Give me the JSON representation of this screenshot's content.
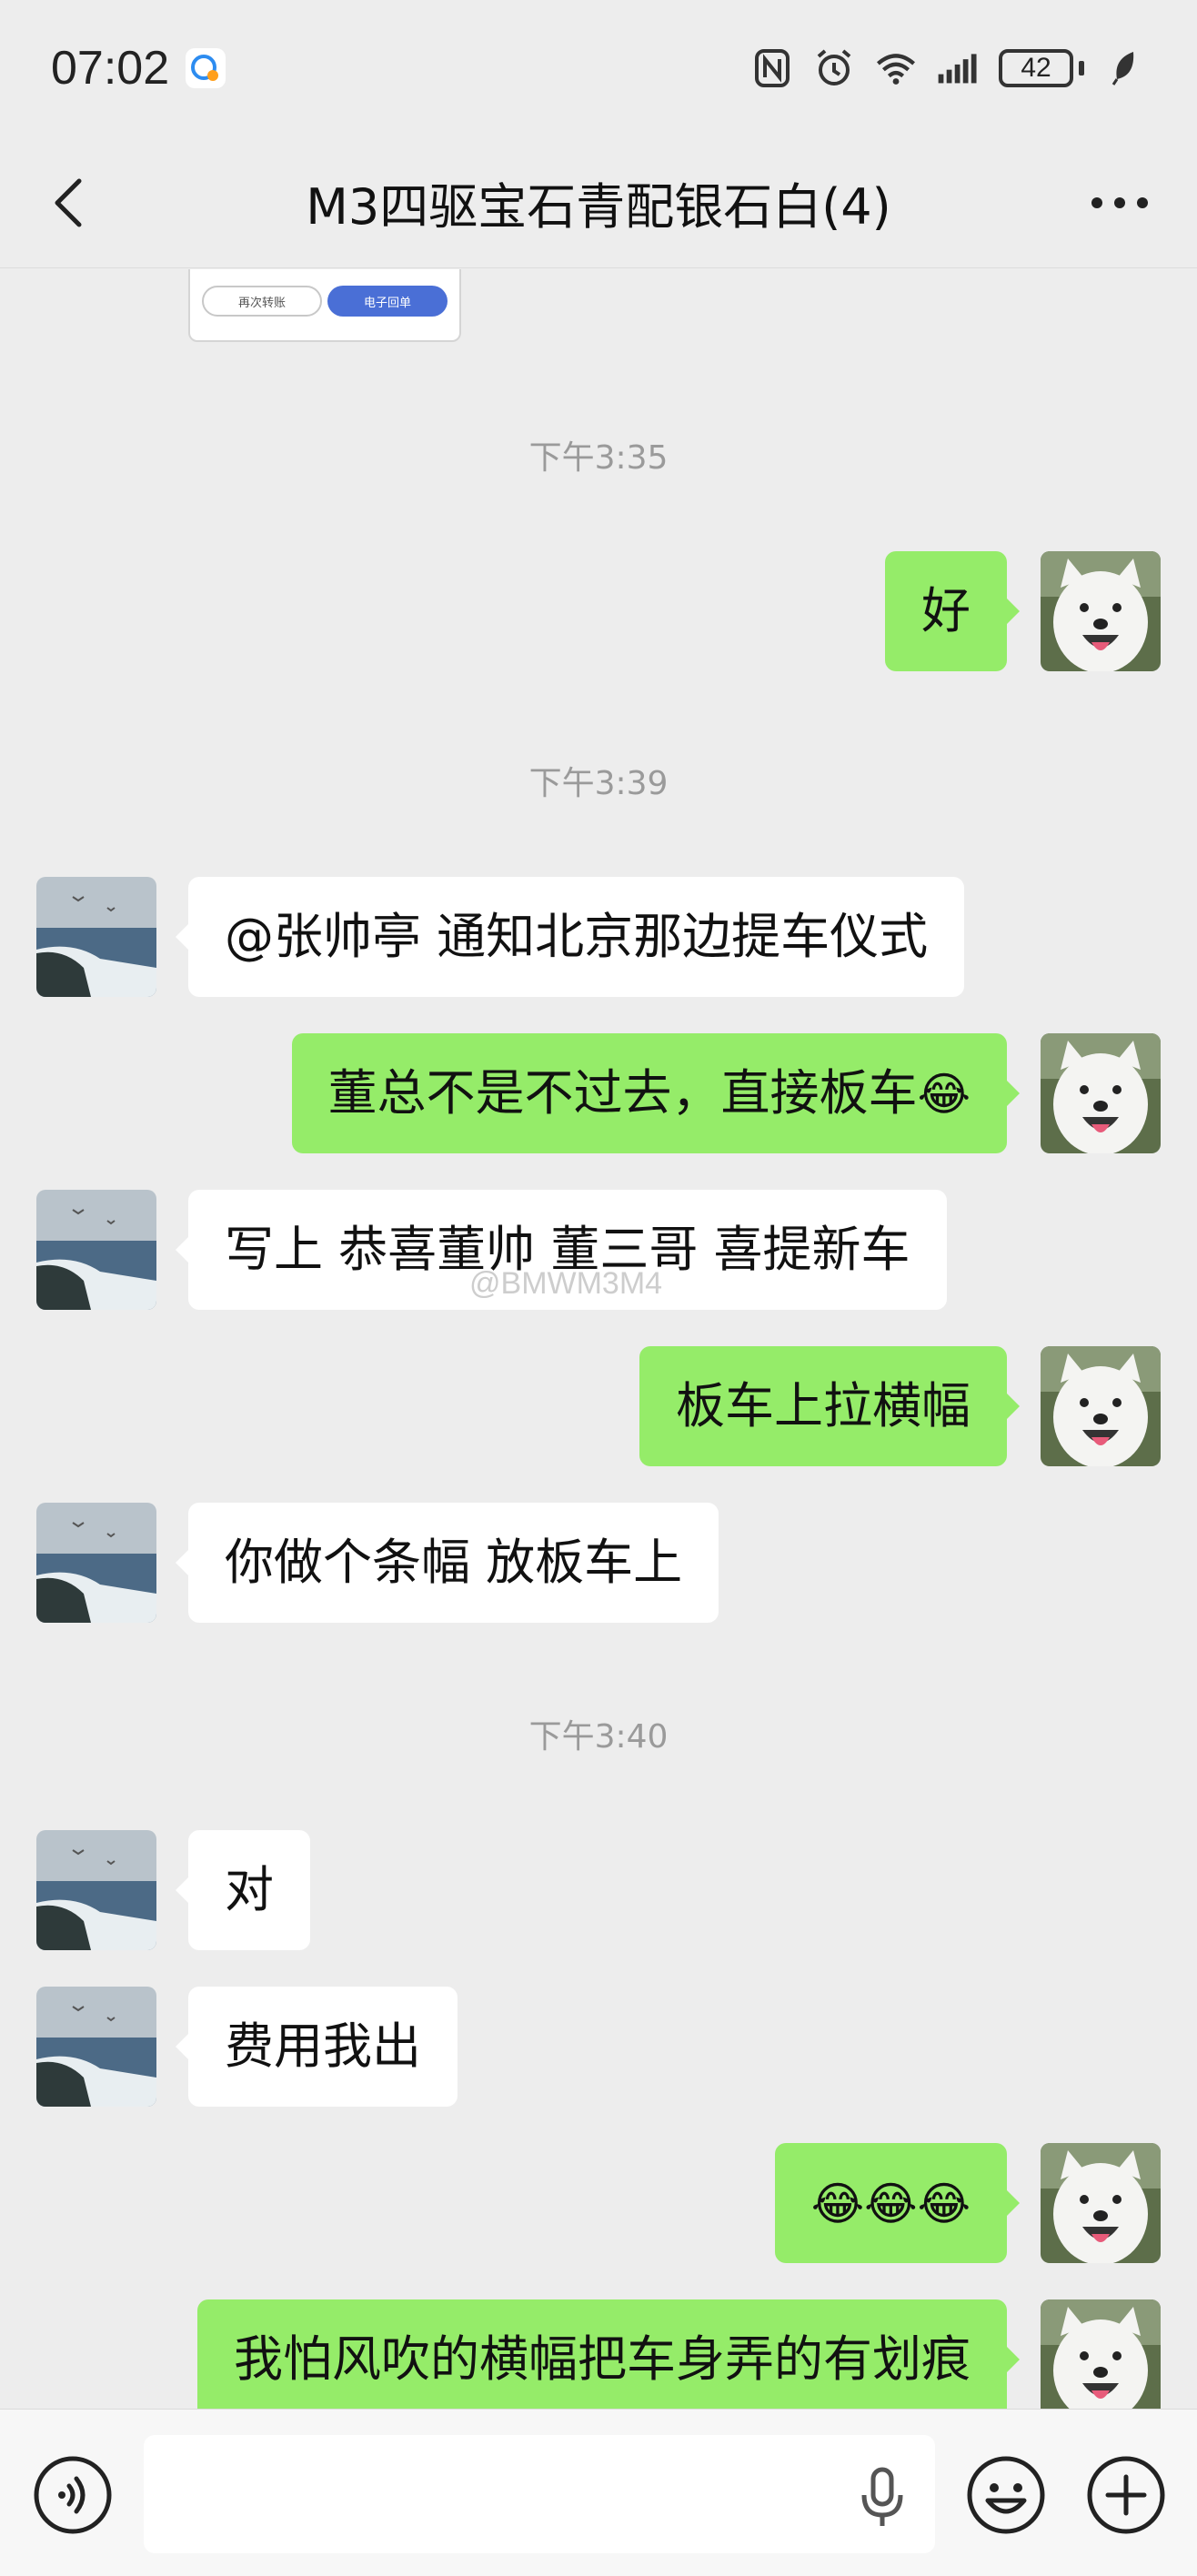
{
  "status_bar": {
    "time": "07:02",
    "battery_level": "42",
    "icons": [
      "messaging-app-icon",
      "nfc-icon",
      "alarm-icon",
      "wifi-icon",
      "signal-icon",
      "battery-icon",
      "leaf-icon"
    ]
  },
  "header": {
    "title": "M3四驱宝石青配银石白(4)",
    "back_icon": "chevron-left-icon",
    "more_icon": "more-dots-icon"
  },
  "chat": {
    "previous_card": {
      "button_a": "再次转账",
      "button_b": "电子回单"
    },
    "timestamps": [
      "下午3:35",
      "下午3:39",
      "下午3:40"
    ],
    "messages": [
      {
        "side": "out",
        "text": "好"
      },
      {
        "side": "in",
        "text": "@张帅亭  通知北京那边提车仪式"
      },
      {
        "side": "out",
        "text": "董总不是不过去，直接板车",
        "emoji": "😂"
      },
      {
        "side": "in",
        "text": "写上 恭喜董帅 董三哥 喜提新车"
      },
      {
        "side": "out",
        "text": "板车上拉横幅"
      },
      {
        "side": "in",
        "text": "你做个条幅 放板车上"
      },
      {
        "side": "in",
        "text": "对"
      },
      {
        "side": "in",
        "text": "费用我出"
      },
      {
        "side": "out",
        "text": "😂😂😂"
      },
      {
        "side": "out",
        "text": "我怕风吹的横幅把车身弄的有划痕"
      }
    ],
    "watermark": "@BMWM3M4"
  },
  "input_bar": {
    "value": "",
    "icons": [
      "voice-icon",
      "microphone-icon",
      "emoji-icon",
      "plus-icon"
    ]
  },
  "colors": {
    "background": "#ededed",
    "outgoing_bubble": "#95ec69",
    "incoming_bubble": "#ffffff",
    "timestamp_text": "#9a9a9a"
  }
}
